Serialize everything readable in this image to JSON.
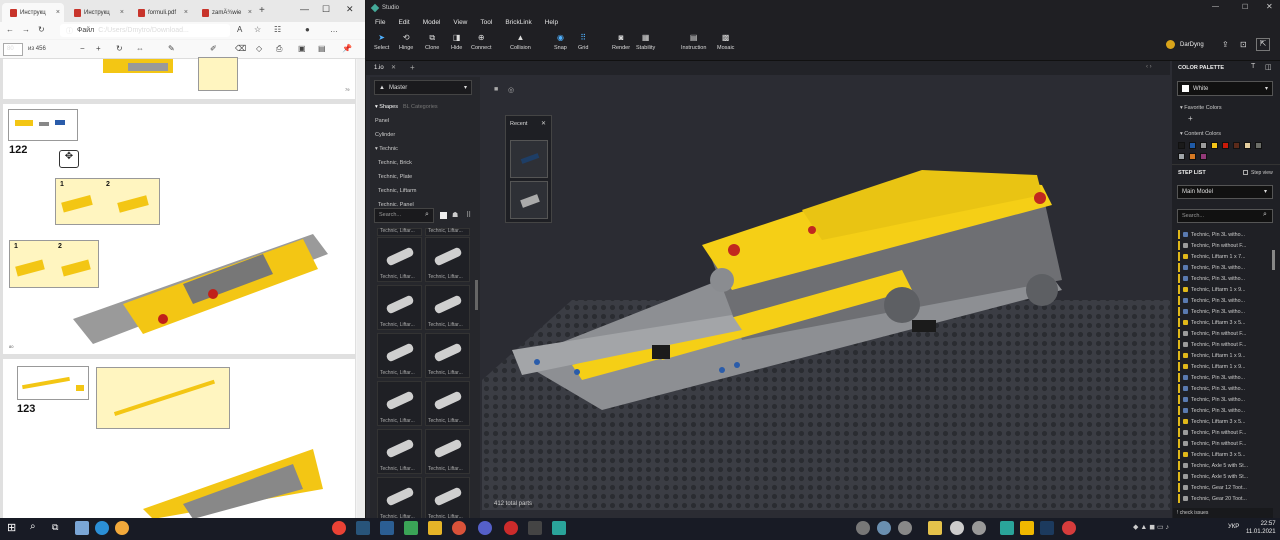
{
  "browser": {
    "tabs": [
      {
        "label": "Инструкц"
      },
      {
        "label": "Инструкц"
      },
      {
        "label": "formuli.pdf"
      },
      {
        "label": "zamÄ¾wie"
      }
    ],
    "address_label": "Файл",
    "address_path": "C:/Users/Dmytro/Download...",
    "page_input": "80",
    "page_count": "из 456",
    "page_numbers": {
      "top": "79",
      "middle": "80"
    },
    "steps": [
      {
        "number": "122"
      },
      {
        "number": "123"
      }
    ],
    "sub_steps": [
      "1",
      "2",
      "1",
      "2"
    ]
  },
  "studio": {
    "window_title": "Studio",
    "menu": [
      "File",
      "Edit",
      "Model",
      "View",
      "Tool",
      "BrickLink",
      "Help"
    ],
    "tools": [
      "Select",
      "Hinge",
      "Clone",
      "Hide",
      "Connect",
      "Collision",
      "Snap",
      "Grid",
      "Render",
      "Stability",
      "Instruction",
      "Mosaic"
    ],
    "user": "DarDyng",
    "doc_tab": "1.io",
    "left": {
      "master": "Master",
      "tab_shapes": "Shapes",
      "tab_bl": "BL Categories",
      "categories": [
        "Panel",
        "Cylinder",
        "Technic",
        "Technic, Brick",
        "Technic, Plate",
        "Technic, Liftarm",
        "Technic, Panel"
      ],
      "search_placeholder": "Search...",
      "part_label": "Technic, Liftar..."
    },
    "recent_title": "Recent",
    "parts_total": "412 total parts",
    "right": {
      "color_palette": "COLOR PALETTE",
      "selected_color": "White",
      "favorite_colors": "Favorite Colors",
      "content_colors": "Content Colors",
      "swatches": [
        "#1a1a1a",
        "#1e5aa8",
        "#9c9c9c",
        "#f5c518",
        "#c91a09",
        "#5b2a1a",
        "#e4cd9e",
        "#6c6e68",
        "#a0a5a9",
        "#d67923",
        "#923978"
      ],
      "step_list": "STEP LIST",
      "step_view": "Step view",
      "main_model": "Main Model",
      "search_placeholder": "Search...",
      "steps": [
        {
          "label": "Technic, Pin 3L witho...",
          "color": "#5a7ab0"
        },
        {
          "label": "Technic, Pin without F...",
          "color": "#9c9c9c"
        },
        {
          "label": "Technic, Liftarm 1 x 7...",
          "color": "#e0b81a"
        },
        {
          "label": "Technic, Pin 3L witho...",
          "color": "#5a7ab0"
        },
        {
          "label": "Technic, Pin 3L witho...",
          "color": "#5a7ab0"
        },
        {
          "label": "Technic, Liftarm 1 x 9...",
          "color": "#e0b81a"
        },
        {
          "label": "Technic, Pin 3L witho...",
          "color": "#5a7ab0"
        },
        {
          "label": "Technic, Pin 3L witho...",
          "color": "#5a7ab0"
        },
        {
          "label": "Technic, Liftarm 3 x 5...",
          "color": "#e0b81a"
        },
        {
          "label": "Technic, Pin without F...",
          "color": "#9c9c9c"
        },
        {
          "label": "Technic, Pin without F...",
          "color": "#9c9c9c"
        },
        {
          "label": "Technic, Liftarm 1 x 9...",
          "color": "#e0b81a"
        },
        {
          "label": "Technic, Liftarm 1 x 9...",
          "color": "#e0b81a"
        },
        {
          "label": "Technic, Pin 3L witho...",
          "color": "#5a7ab0"
        },
        {
          "label": "Technic, Pin 3L witho...",
          "color": "#5a7ab0"
        },
        {
          "label": "Technic, Pin 3L witho...",
          "color": "#5a7ab0"
        },
        {
          "label": "Technic, Pin 3L witho...",
          "color": "#5a7ab0"
        },
        {
          "label": "Technic, Liftarm 3 x 5...",
          "color": "#e0b81a"
        },
        {
          "label": "Technic, Pin without F...",
          "color": "#9c9c9c"
        },
        {
          "label": "Technic, Pin without F...",
          "color": "#9c9c9c"
        },
        {
          "label": "Technic, Liftarm 3 x 5...",
          "color": "#e0b81a"
        },
        {
          "label": "Technic, Axle 5 with St...",
          "color": "#9c9c9c"
        },
        {
          "label": "Technic, Axle 5 with St...",
          "color": "#9c9c9c"
        },
        {
          "label": "Technic, Gear 12 Toot...",
          "color": "#9c9c9c"
        },
        {
          "label": "Technic, Gear 20 Toot...",
          "color": "#9c9c9c"
        }
      ],
      "check_issues": "check issues"
    }
  },
  "taskbar": {
    "lang": "УКР",
    "time": "22:57",
    "date": "11.01.2021"
  }
}
